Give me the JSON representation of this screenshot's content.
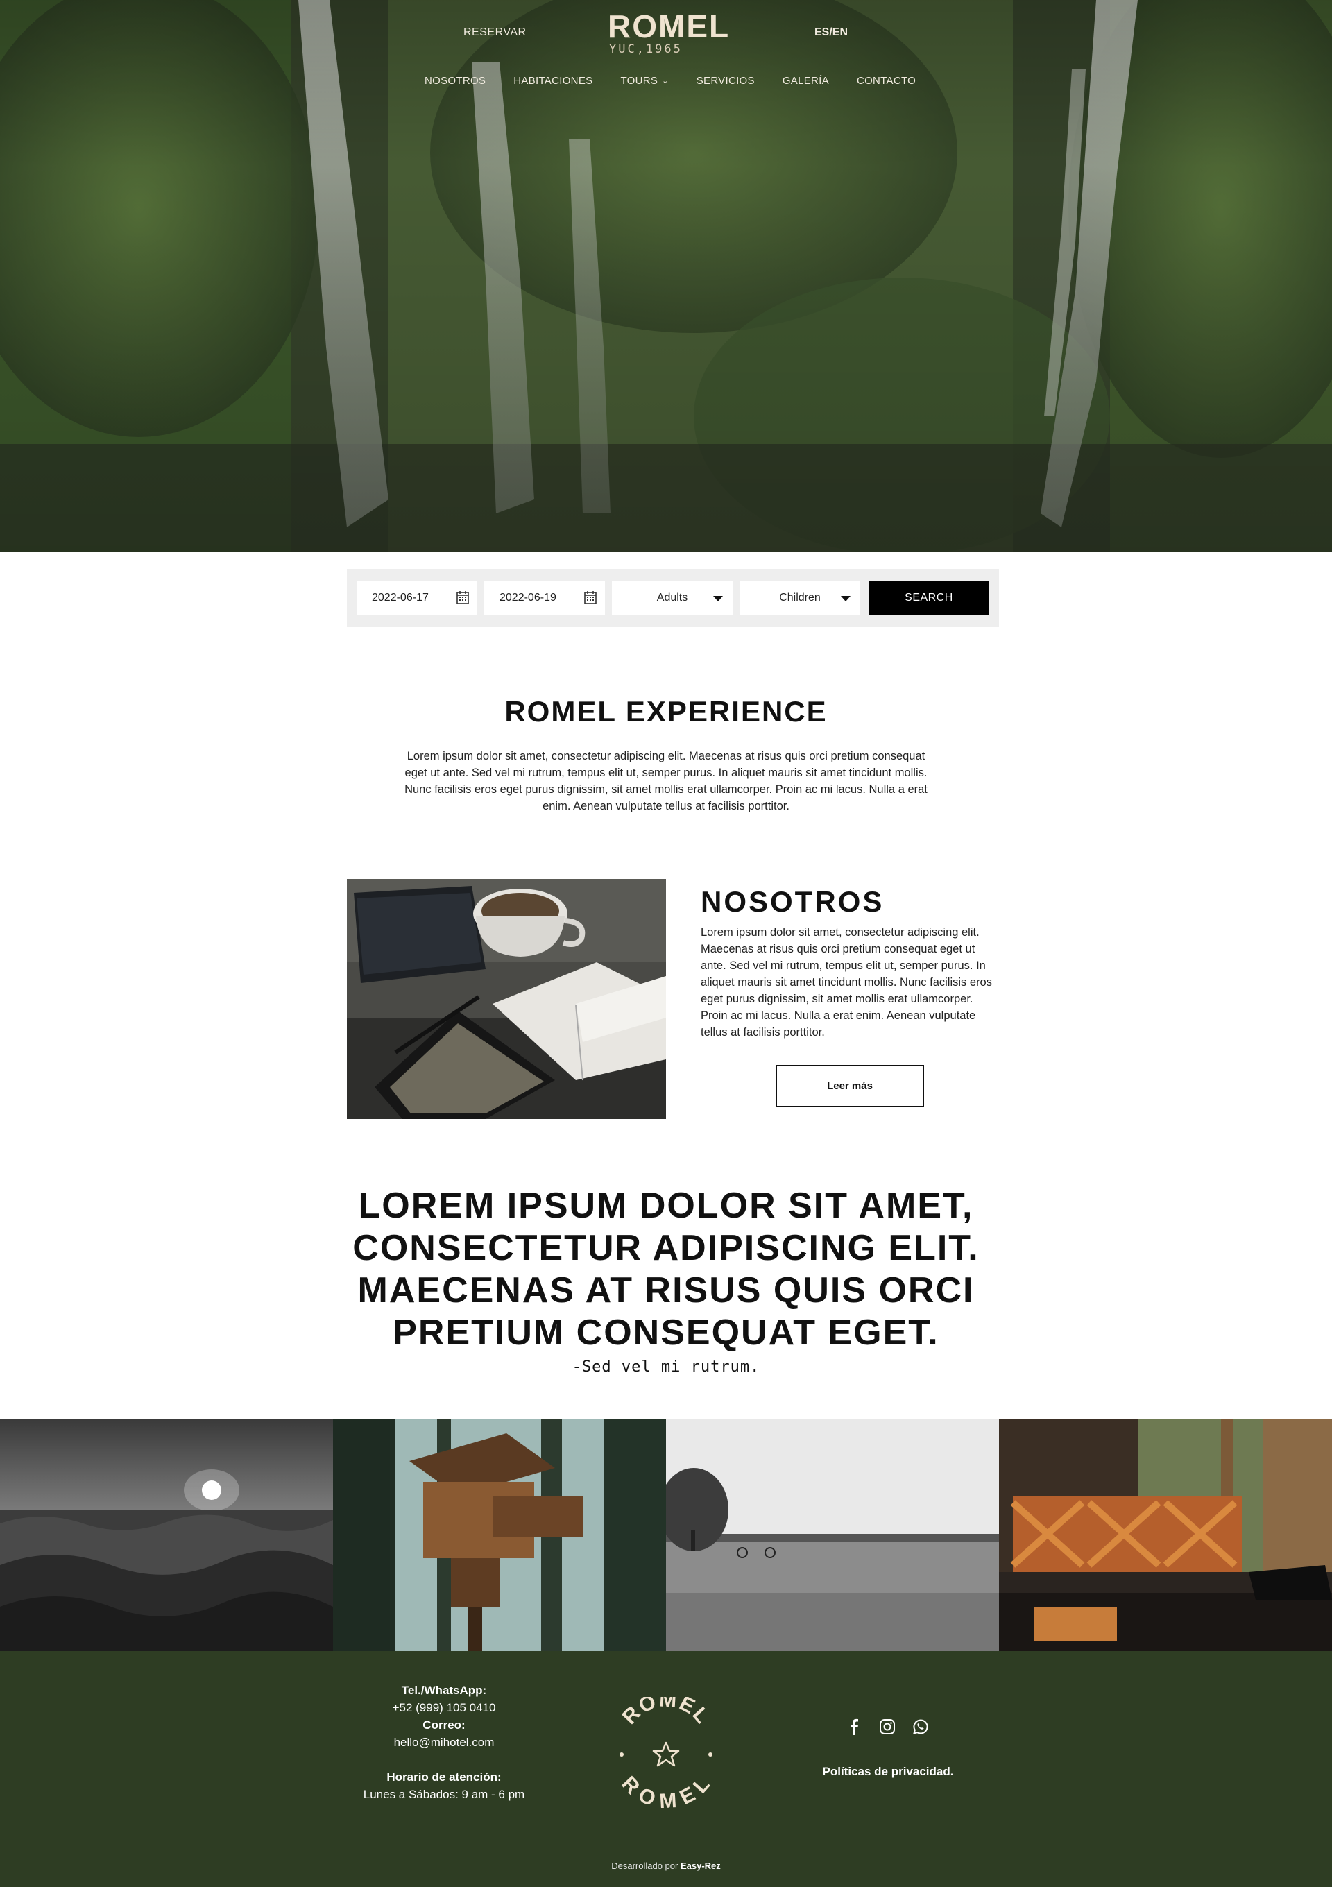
{
  "header": {
    "reservar": "RESERVAR",
    "logo_name": "ROMEL",
    "logo_sub": "YUC,1965",
    "lang": "ES/EN",
    "nav": [
      "NOSOTROS",
      "HABITACIONES",
      "TOURS",
      "SERVICIOS",
      "GALERÍA",
      "CONTACTO"
    ]
  },
  "search": {
    "checkin": "2022-06-17",
    "checkout": "2022-06-19",
    "adults": "Adults",
    "children": "Children",
    "button": "SEARCH"
  },
  "experience": {
    "title": "ROMEL EXPERIENCE",
    "text": "Lorem ipsum dolor sit amet, consectetur adipiscing elit. Maecenas at risus quis orci pretium consequat eget ut ante. Sed vel mi rutrum, tempus elit ut, semper purus. In aliquet mauris sit amet tincidunt mollis. Nunc facilisis eros eget purus dignissim, sit amet mollis erat ullamcorper. Proin ac mi lacus. Nulla a erat enim. Aenean vulputate tellus at facilisis porttitor."
  },
  "about": {
    "title": "NOSOTROS",
    "text": "Lorem ipsum dolor sit amet, consectetur adipiscing elit. Maecenas at risus quis orci pretium consequat eget ut ante. Sed vel mi rutrum, tempus elit ut, semper purus. In aliquet mauris sit amet tincidunt mollis. Nunc facilisis eros eget purus dignissim, sit amet mollis erat ullamcorper. Proin ac mi lacus. Nulla a erat enim. Aenean vulputate tellus at facilisis porttitor.",
    "button": "Leer más"
  },
  "quote": {
    "text": "LOREM IPSUM DOLOR SIT AMET, CONSECTETUR ADIPISCING ELIT. MAECENAS AT RISUS QUIS ORCI PRETIUM CONSEQUAT EGET.",
    "author": "-Sed vel mi rutrum."
  },
  "footer": {
    "phone_label": "Tel./WhatsApp:",
    "phone": "+52 (999) 105 0410",
    "email_label": "Correo:",
    "email": "hello@mihotel.com",
    "hours_label": "Horario de atención:",
    "hours": "Lunes a Sábados: 9 am - 6 pm",
    "logo_top": "ROMEL",
    "logo_bottom": "ROMEL",
    "social_icons": [
      "facebook-icon",
      "instagram-icon",
      "whatsapp-icon"
    ],
    "privacy": "Políticas de privacidad.",
    "credit_prefix": "Desarrollado por",
    "credit_brand": "Easy-Rez"
  },
  "colors": {
    "footer_bg": "#2e3d23",
    "logo_cream": "#efe3cf",
    "search_button": "#000000"
  }
}
